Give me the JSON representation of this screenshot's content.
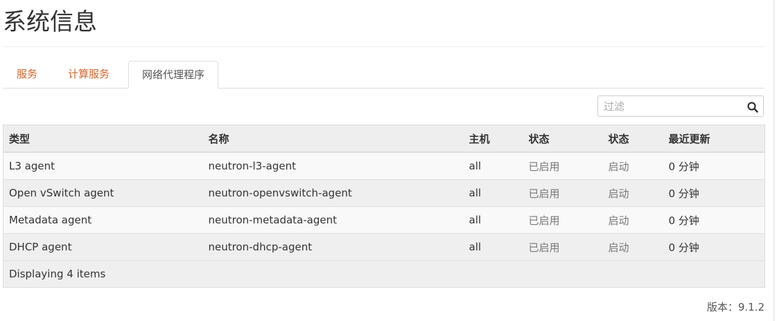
{
  "page": {
    "title": "系统信息"
  },
  "tabs": [
    {
      "label": "服务",
      "active": false
    },
    {
      "label": "计算服务",
      "active": false
    },
    {
      "label": "网络代理程序",
      "active": true
    }
  ],
  "filter": {
    "placeholder": "过滤",
    "value": "",
    "icon": "search-icon"
  },
  "table": {
    "columns": [
      "类型",
      "名称",
      "主机",
      "状态",
      "状态",
      "最近更新"
    ],
    "rows": [
      [
        "L3 agent",
        "neutron-l3-agent",
        "all",
        "已启用",
        "启动",
        "0 分钟"
      ],
      [
        "Open vSwitch agent",
        "neutron-openvswitch-agent",
        "all",
        "已启用",
        "启动",
        "0 分钟"
      ],
      [
        "Metadata agent",
        "neutron-metadata-agent",
        "all",
        "已启用",
        "启动",
        "0 分钟"
      ],
      [
        "DHCP agent",
        "neutron-dhcp-agent",
        "all",
        "已启用",
        "启动",
        "0 分钟"
      ]
    ],
    "footer": "Displaying 4 items"
  },
  "footer": {
    "version": "版本：9.1.2"
  },
  "colors": {
    "tab_link": "#d4642a",
    "header_bg": "#eeeeee",
    "border": "#dddddd"
  }
}
